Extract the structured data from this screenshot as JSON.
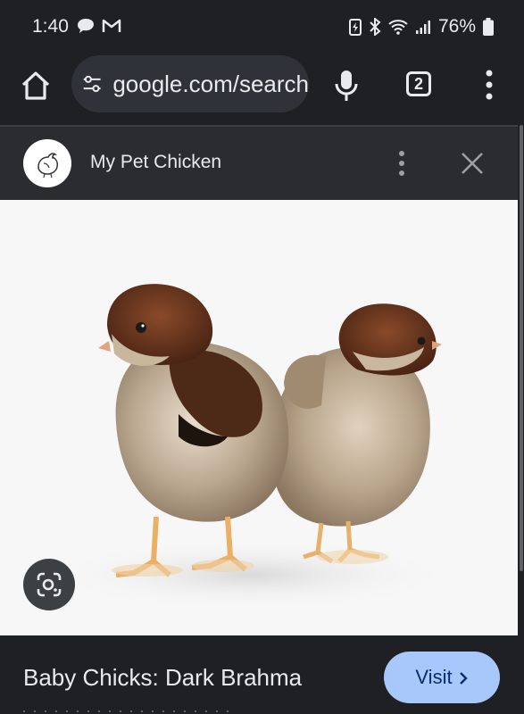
{
  "status_bar": {
    "time": "1:40",
    "battery_percent": "76%"
  },
  "toolbar": {
    "url": "google.com/search",
    "tab_count": "2"
  },
  "sheet": {
    "site_name": "My Pet Chicken"
  },
  "result": {
    "title": "Baby Chicks: Dark Brahma",
    "visit_label": "Visit"
  },
  "colors": {
    "background": "#1f2023",
    "visit_button": "#a8c7fa"
  }
}
